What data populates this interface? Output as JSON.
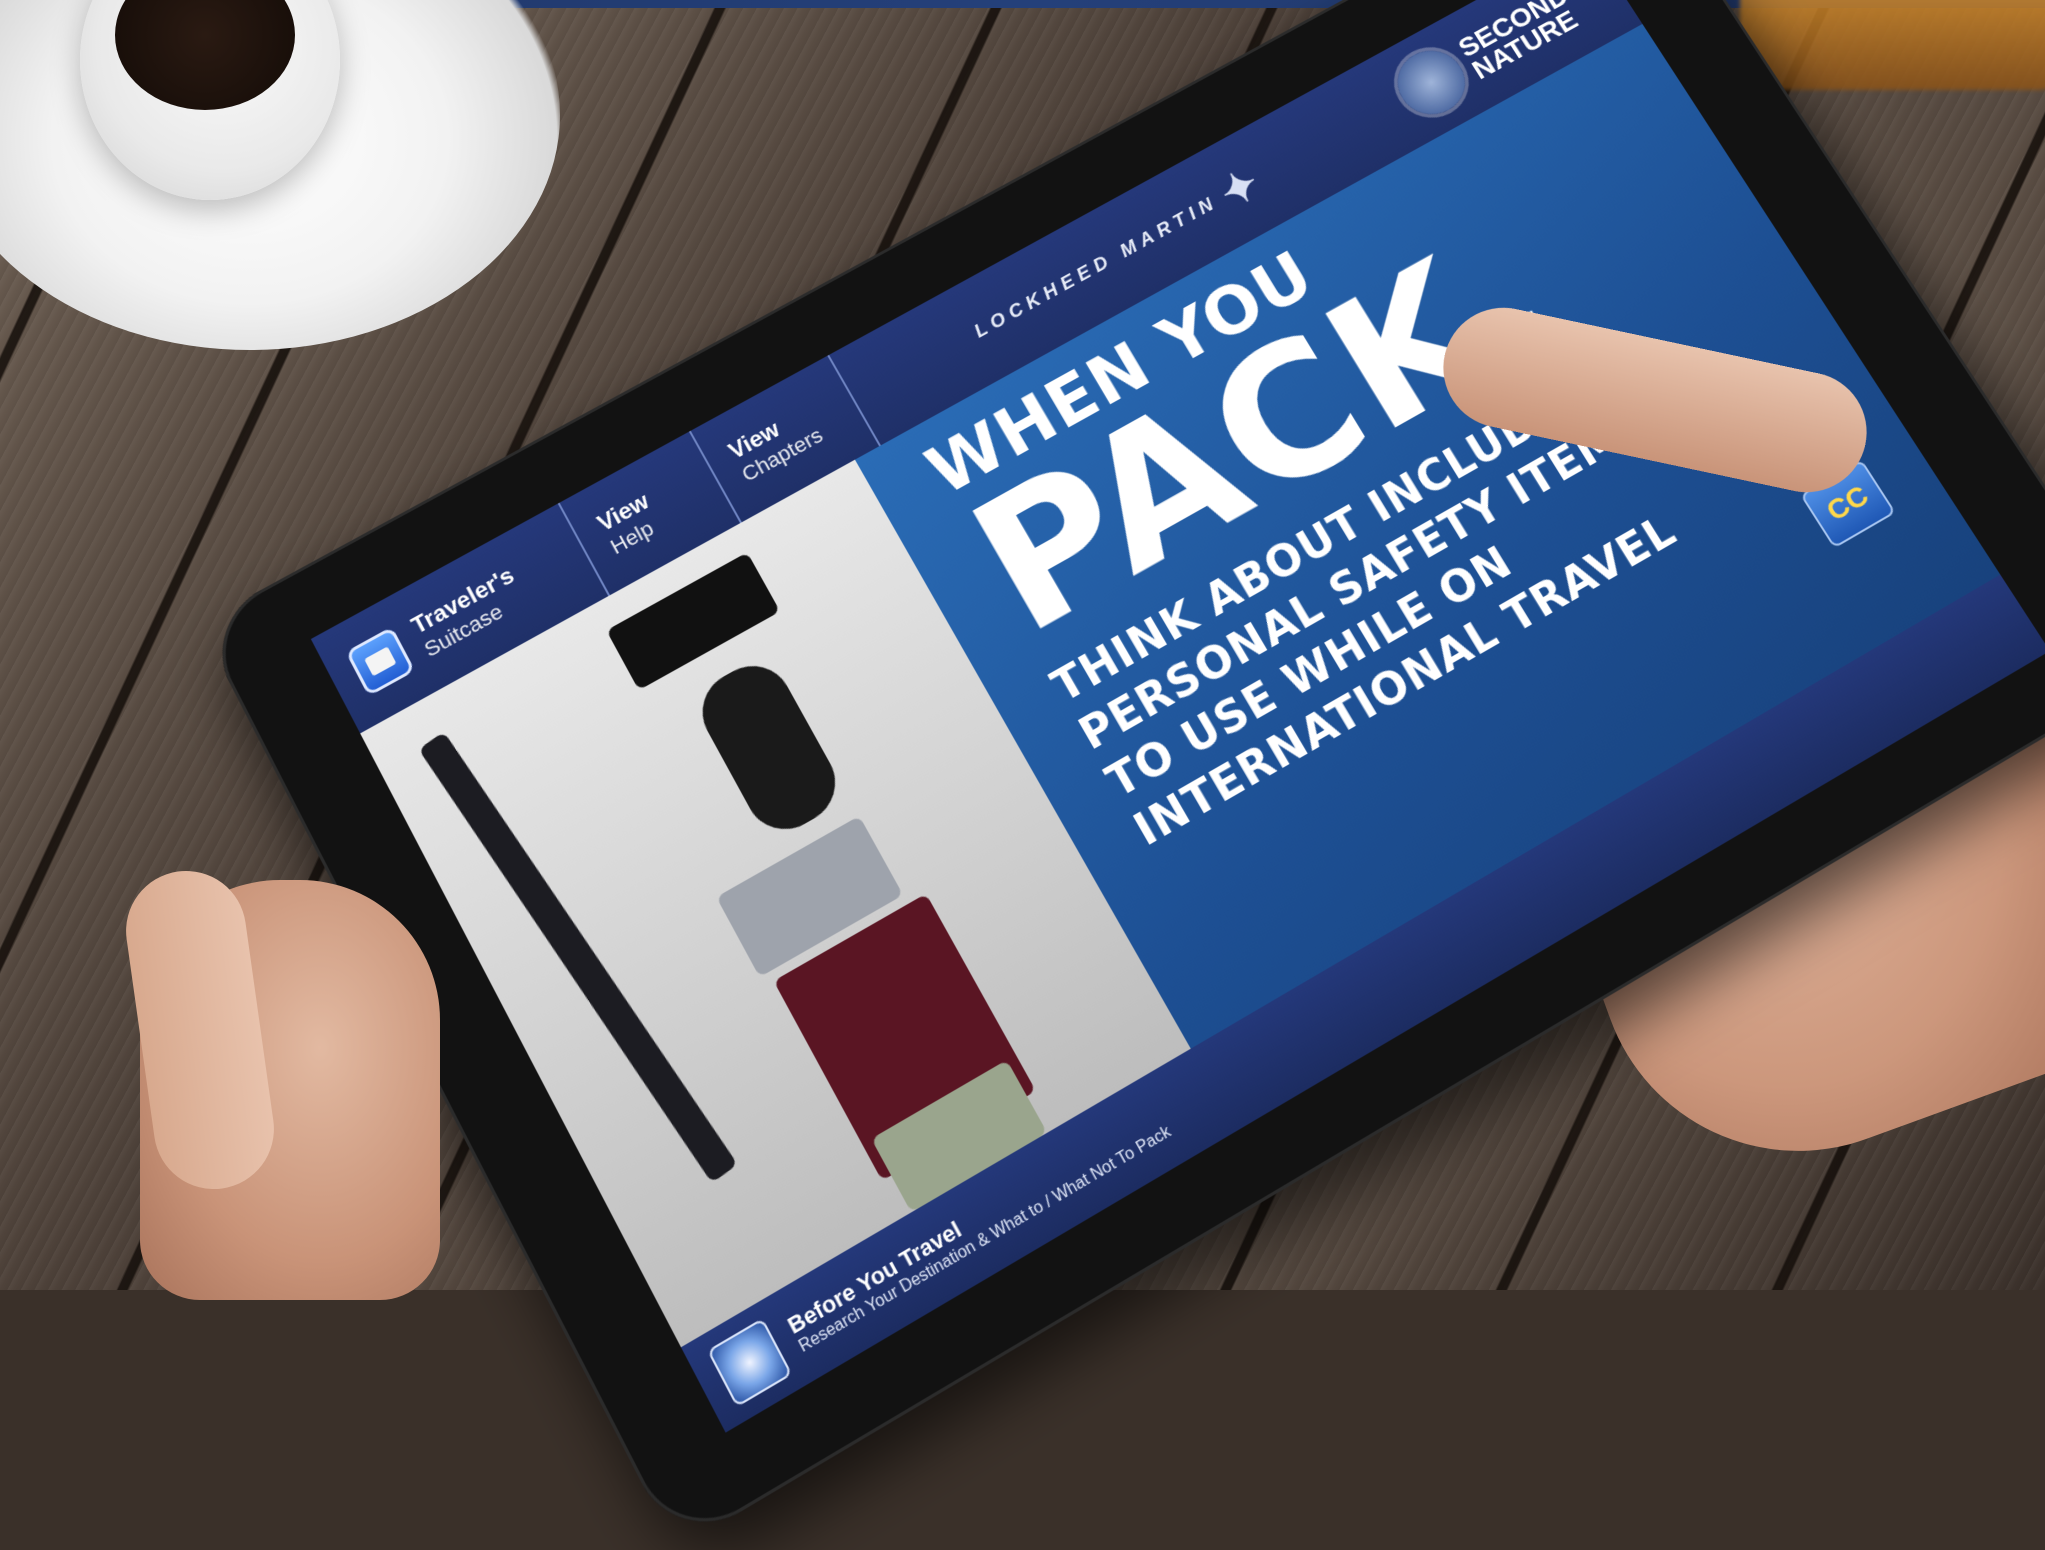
{
  "tablet": {
    "tabs": [
      {
        "title": "Traveler's",
        "subtitle": "Suitcase"
      },
      {
        "title": "View",
        "subtitle": "Help"
      },
      {
        "title": "View",
        "subtitle": "Chapters"
      }
    ],
    "brand": "LOCKHEED MARTIN",
    "logo": {
      "line1": "SECOND",
      "line2": "NATURE"
    },
    "headline": {
      "line1": "WHEN YOU",
      "line2": "PACK,",
      "body": [
        "THINK ABOUT INCLUDING",
        "PERSONAL SAFETY ITEMS",
        "TO USE WHILE ON",
        "INTERNATIONAL TRAVEL"
      ]
    },
    "cc_label": "CC",
    "bottom": {
      "title": "Before You Travel",
      "subtitle": "Research Your Destination & What to / What Not To Pack"
    }
  },
  "colors": {
    "nav_blue": "#1f3068",
    "panel_blue": "#1d4f93",
    "cc_text": "#ffd84a"
  },
  "icons": [
    "suitcase-icon",
    "star-icon",
    "globe-icon",
    "logo-mark-icon"
  ]
}
